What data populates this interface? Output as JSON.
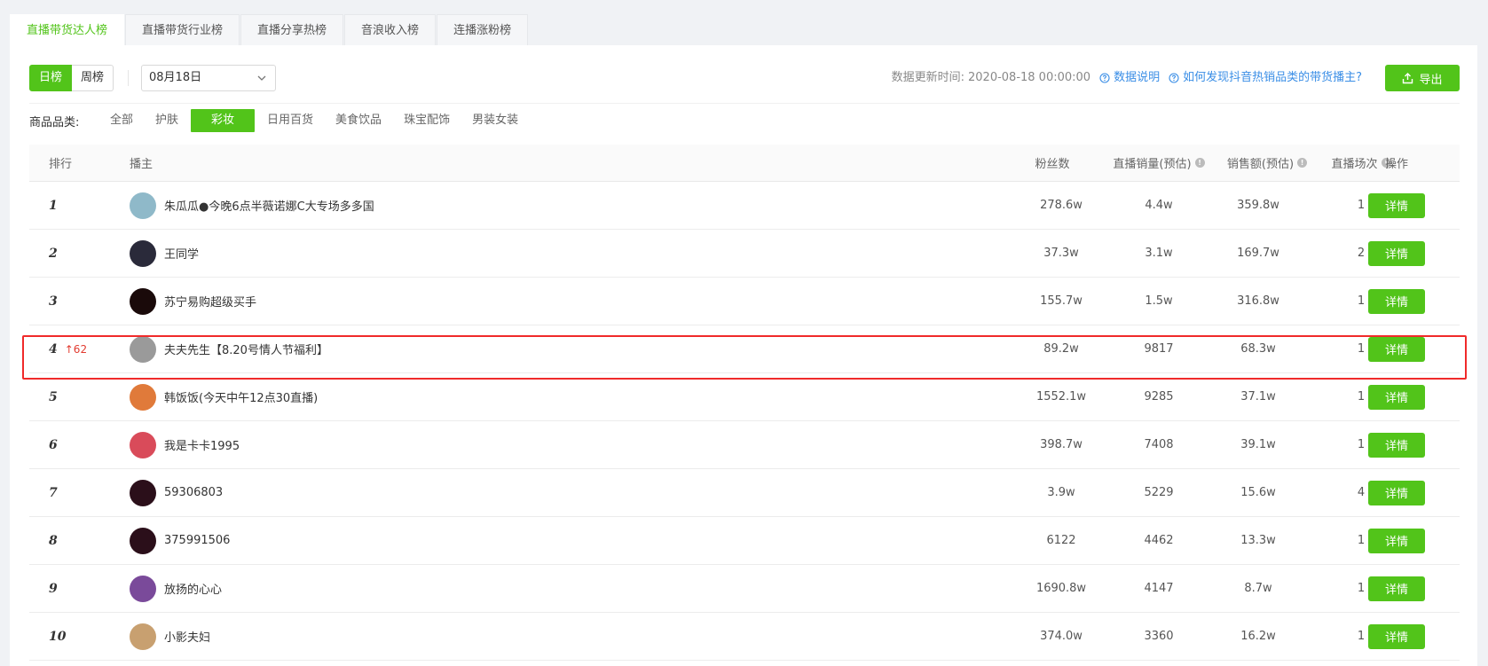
{
  "tabs": [
    "直播带货达人榜",
    "直播带货行业榜",
    "直播分享热榜",
    "音浪收入榜",
    "连播涨粉榜"
  ],
  "active_tab": 0,
  "period_toggle": {
    "day": "日榜",
    "week": "周榜",
    "active": "day"
  },
  "date_select": {
    "value": "08月18日"
  },
  "update_info": {
    "label": "数据更新时间:",
    "time": "2020-08-18 00:00:00",
    "help_link": "数据说明",
    "faq_link": "如何发现抖音热销品类的带货播主?"
  },
  "export_label": "导出",
  "category": {
    "label": "商品品类:",
    "items": [
      "全部",
      "护肤",
      "彩妆",
      "日用百货",
      "美食饮品",
      "珠宝配饰",
      "男装女装"
    ],
    "active": 2
  },
  "table": {
    "headers": {
      "rank": "排行",
      "anchor": "播主",
      "fans": "粉丝数",
      "volume": "直播销量(预估)",
      "amount": "销售额(预估)",
      "sessions": "直播场次",
      "op": "操作"
    },
    "detail_label": "详情",
    "rows": [
      {
        "rank": "1",
        "change": "",
        "name": "朱瓜瓜●今晚6点半薇诺娜C大专场多多国",
        "fans": "278.6w",
        "volume": "4.4w",
        "amount": "359.8w",
        "sessions": "1",
        "avatar_color": "#8fb9c9"
      },
      {
        "rank": "2",
        "change": "",
        "name": "王同学",
        "fans": "37.3w",
        "volume": "3.1w",
        "amount": "169.7w",
        "sessions": "2",
        "avatar_color": "#2a2a3a"
      },
      {
        "rank": "3",
        "change": "",
        "name": "苏宁易购超级买手",
        "fans": "155.7w",
        "volume": "1.5w",
        "amount": "316.8w",
        "sessions": "1",
        "avatar_color": "#1a0a0a"
      },
      {
        "rank": "4",
        "change": "↑62",
        "name": "夫夫先生【8.20号情人节福利】",
        "fans": "89.2w",
        "volume": "9817",
        "amount": "68.3w",
        "sessions": "1",
        "avatar_color": "#9a9a9a"
      },
      {
        "rank": "5",
        "change": "",
        "name": "韩饭饭(今天中午12点30直播)",
        "fans": "1552.1w",
        "volume": "9285",
        "amount": "37.1w",
        "sessions": "1",
        "avatar_color": "#e07a3a"
      },
      {
        "rank": "6",
        "change": "",
        "name": "我是卡卡1995",
        "fans": "398.7w",
        "volume": "7408",
        "amount": "39.1w",
        "sessions": "1",
        "avatar_color": "#d94b5a"
      },
      {
        "rank": "7",
        "change": "",
        "name": "59306803",
        "fans": "3.9w",
        "volume": "5229",
        "amount": "15.6w",
        "sessions": "4",
        "avatar_color": "#2b0f1a"
      },
      {
        "rank": "8",
        "change": "",
        "name": "375991506",
        "fans": "6122",
        "volume": "4462",
        "amount": "13.3w",
        "sessions": "1",
        "avatar_color": "#2b0f1a"
      },
      {
        "rank": "9",
        "change": "",
        "name": "放扬的心心",
        "fans": "1690.8w",
        "volume": "4147",
        "amount": "8.7w",
        "sessions": "1",
        "avatar_color": "#7a4a9a"
      },
      {
        "rank": "10",
        "change": "",
        "name": "小影夫妇",
        "fans": "374.0w",
        "volume": "3360",
        "amount": "16.2w",
        "sessions": "1",
        "avatar_color": "#c8a070"
      }
    ]
  }
}
